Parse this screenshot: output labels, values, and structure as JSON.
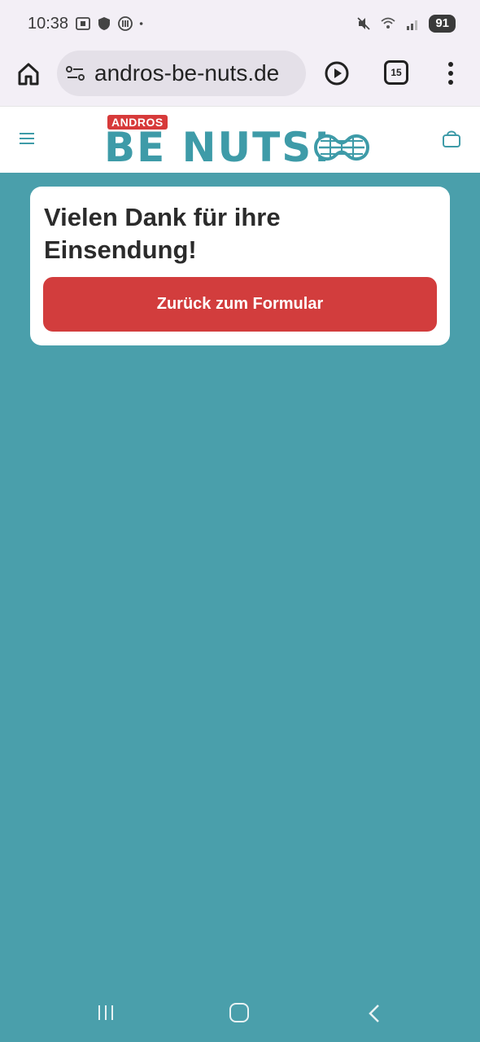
{
  "status_bar": {
    "time": "10:38",
    "battery": "91",
    "icons": [
      "screenshot-icon",
      "shield-icon",
      "vpn-icon",
      "dot-icon",
      "mute-icon",
      "wifi-icon",
      "signal-icon",
      "battery-icon"
    ]
  },
  "browser": {
    "url": "andros-be-nuts.de",
    "tab_count": "15"
  },
  "site": {
    "brand_small": "ANDROS",
    "brand_large": "BE NUTS!",
    "brand_color": "#3e9ba8",
    "accent_color": "#d23d3d",
    "background_color": "#4a9fab"
  },
  "card": {
    "title": "Vielen Dank für ihre Einsendung!",
    "button_label": "Zurück zum Formular"
  }
}
